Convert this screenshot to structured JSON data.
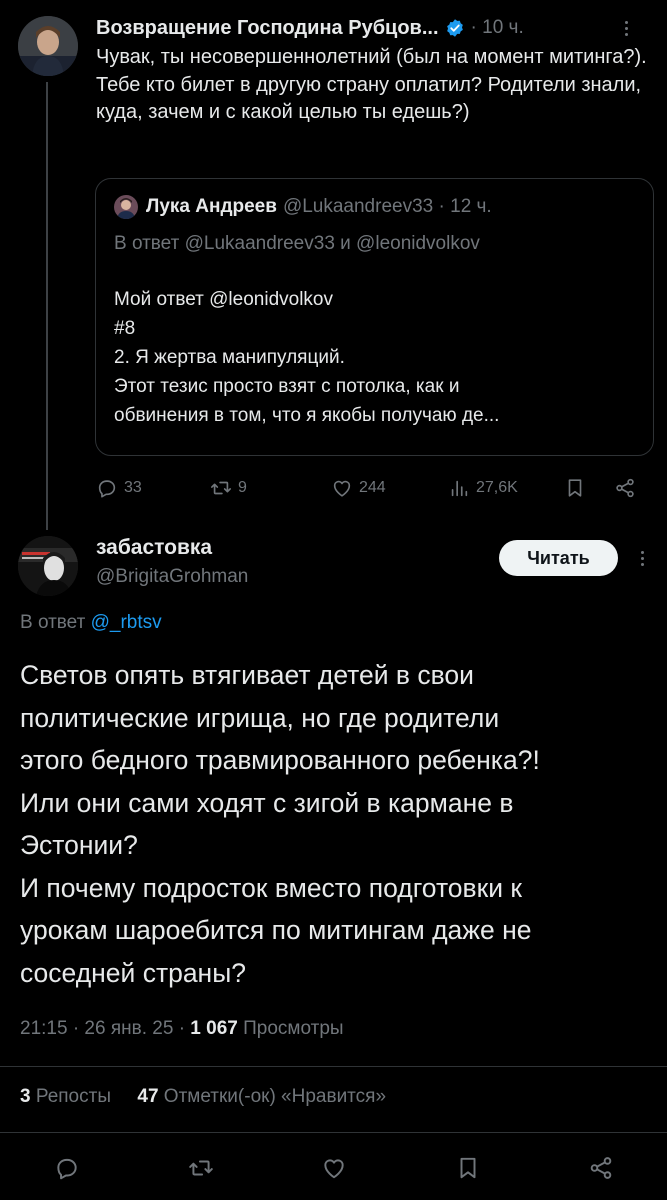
{
  "parent_tweet": {
    "author_name": "Возвращение Господина Рубцов...",
    "verified": true,
    "time": "10 ч.",
    "text": "Чувак, ты несовершеннолетний (был на момент митинга?). Тебе кто билет в другую страну оплатил? Родители знали, куда, зачем и с какой целью ты едешь?)",
    "quote": {
      "author_name": "Лука Андреев",
      "author_handle": "@Lukaandreev33",
      "time": "12 ч.",
      "reply_to": "В ответ @Lukaandreev33 и @leonidvolkov",
      "lines": [
        "Мой ответ @leonidvolkov",
        "#8",
        "2. Я жертва манипуляций.",
        "Этот тезис просто взят с потолка, как и",
        "обвинения в том, что я якобы получаю де..."
      ]
    },
    "actions": {
      "replies": "33",
      "reposts": "9",
      "likes": "244",
      "views": "27,6K"
    }
  },
  "main_tweet": {
    "author_name": "забастовка",
    "author_handle": "@BrigitaGrohman",
    "follow_label": "Читать",
    "reply_prefix": "В ответ",
    "reply_mention": "@_rbtsv",
    "text_lines": [
      "Светов опять втягивает детей в свои",
      "политические игрища, но где родители",
      "этого бедного травмированного ребенка?!",
      "Или они сами ходят с зигой в кармане в",
      "Эстонии?",
      "И почему подросток вместо подготовки к",
      "урокам шароебится по митингам даже не",
      "соседней страны?"
    ],
    "meta": {
      "time_date": "21:15 · 26 янв. 25 · ",
      "views_count": "1 067",
      "views_label": " Просмотры"
    },
    "stats": {
      "reposts_count": "3",
      "reposts_label": " Репосты",
      "likes_count": "47",
      "likes_label": " Отметки(-ок) «Нравится»"
    }
  },
  "icons": [
    "verified-badge-icon",
    "reply-icon",
    "repost-icon",
    "like-icon",
    "views-icon",
    "bookmark-icon",
    "share-icon",
    "more-icon"
  ],
  "colors": {
    "background": "#000000",
    "text": "#e7e9ea",
    "muted": "#71767b",
    "accent": "#1d9bf0",
    "border": "#2f3336"
  }
}
